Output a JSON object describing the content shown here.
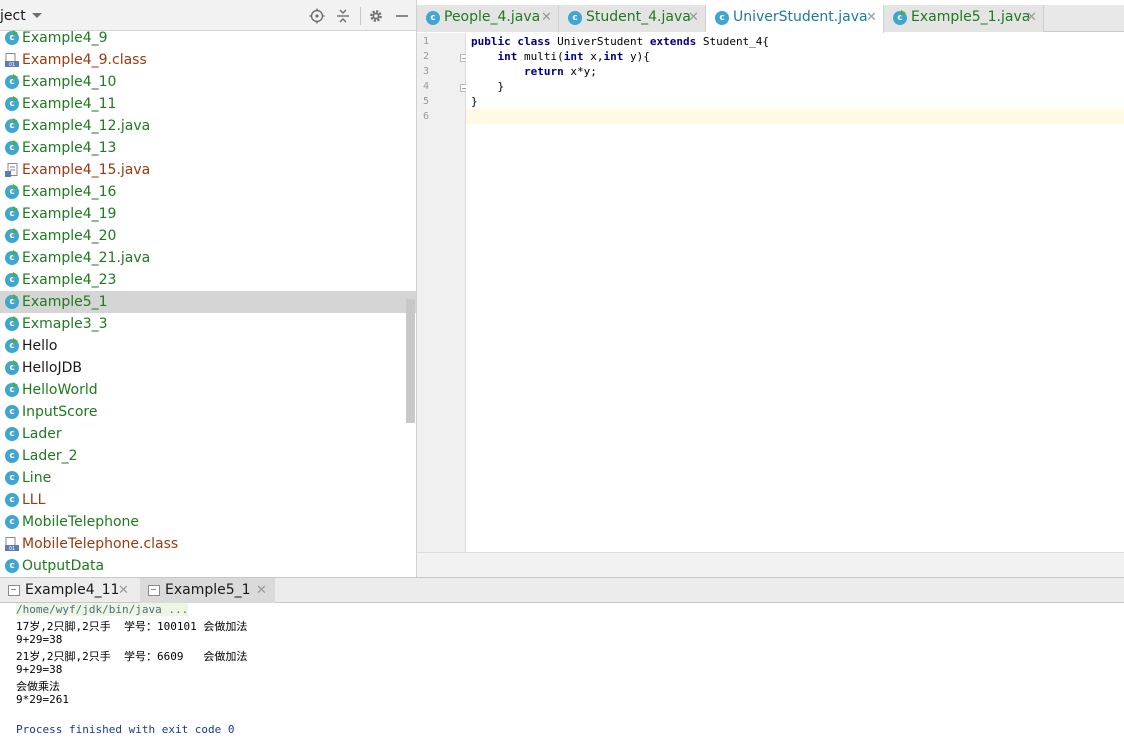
{
  "project_panel": {
    "title": "ject",
    "items": [
      {
        "label": "Example4_9",
        "icon": "class-run-icon",
        "color": "green"
      },
      {
        "label": "Example4_9.class",
        "icon": "class-file-icon",
        "color": "brown"
      },
      {
        "label": "Example4_10",
        "icon": "class-run-icon",
        "color": "green"
      },
      {
        "label": "Example4_11",
        "icon": "class-run-icon",
        "color": "green"
      },
      {
        "label": "Example4_12.java",
        "icon": "class-run-icon",
        "color": "green"
      },
      {
        "label": "Example4_13",
        "icon": "class-run-icon",
        "color": "green"
      },
      {
        "label": "Example4_15.java",
        "icon": "java-file-icon",
        "color": "brown"
      },
      {
        "label": "Example4_16",
        "icon": "class-run-icon",
        "color": "green"
      },
      {
        "label": "Example4_19",
        "icon": "class-run-icon",
        "color": "green"
      },
      {
        "label": "Example4_20",
        "icon": "class-run-icon",
        "color": "green"
      },
      {
        "label": "Example4_21.java",
        "icon": "class-run-icon",
        "color": "green"
      },
      {
        "label": "Example4_23",
        "icon": "class-run-icon",
        "color": "green"
      },
      {
        "label": "Example5_1",
        "icon": "class-run-icon",
        "color": "green",
        "selected": true
      },
      {
        "label": "Exmaple3_3",
        "icon": "class-run-icon",
        "color": "green"
      },
      {
        "label": "Hello",
        "icon": "class-run-icon",
        "color": "dark"
      },
      {
        "label": "HelloJDB",
        "icon": "class-run-icon",
        "color": "dark"
      },
      {
        "label": "HelloWorld",
        "icon": "class-run-icon",
        "color": "green"
      },
      {
        "label": "InputScore",
        "icon": "class-icon",
        "color": "green"
      },
      {
        "label": "Lader",
        "icon": "class-icon",
        "color": "green"
      },
      {
        "label": "Lader_2",
        "icon": "class-icon",
        "color": "green"
      },
      {
        "label": "Line",
        "icon": "class-icon",
        "color": "green"
      },
      {
        "label": "LLL",
        "icon": "class-icon",
        "color": "brown"
      },
      {
        "label": "MobileTelephone",
        "icon": "class-icon",
        "color": "green"
      },
      {
        "label": "MobileTelephone.class",
        "icon": "class-file-icon",
        "color": "brown"
      },
      {
        "label": "OutputData",
        "icon": "class-icon",
        "color": "green"
      }
    ]
  },
  "editor": {
    "tabs": [
      {
        "label": "People_4.java",
        "icon": "class-icon",
        "active": false
      },
      {
        "label": "Student_4.java",
        "icon": "class-icon",
        "active": false
      },
      {
        "label": "UniverStudent.java",
        "icon": "class-icon",
        "active": true
      },
      {
        "label": "Example5_1.java",
        "icon": "class-run-icon",
        "active": false
      }
    ],
    "line_numbers": [
      "1",
      "2",
      "3",
      "4",
      "5",
      "6"
    ],
    "code": {
      "l1_kw1": "public",
      "l1_kw2": "class",
      "l1_name": " UniverStudent ",
      "l1_kw3": "extends",
      "l1_rest": " Student_4{",
      "l2_kw1": "int",
      "l2_mid": " multi(",
      "l2_kw2": "int",
      "l2_mid2": " x,",
      "l2_kw3": "int",
      "l2_rest": " y){",
      "l3_kw": "return",
      "l3_rest": " x*y;",
      "l4": "}",
      "l5": "}"
    }
  },
  "run_panel": {
    "tabs": [
      {
        "label": "Example4_11",
        "active": false
      },
      {
        "label": "Example5_1",
        "active": true
      }
    ],
    "console": {
      "command": "/home/wyf/jdk/bin/java ...",
      "lines": [
        "17岁,2只脚,2只手  学号：100101 会做加法",
        "9+29=38",
        "21岁,2只脚,2只手  学号：6609   会做加法",
        "9+29=38",
        "会做乘法",
        "9*29=261",
        ""
      ],
      "exit": "Process finished with exit code 0"
    }
  },
  "colors": {
    "green": "#1e7a1e",
    "dark": "#1a1a1a",
    "brown": "#9a3a10",
    "keyword": "#000080",
    "selection": "#d5d5d5",
    "caret_line": "#fffae3"
  }
}
